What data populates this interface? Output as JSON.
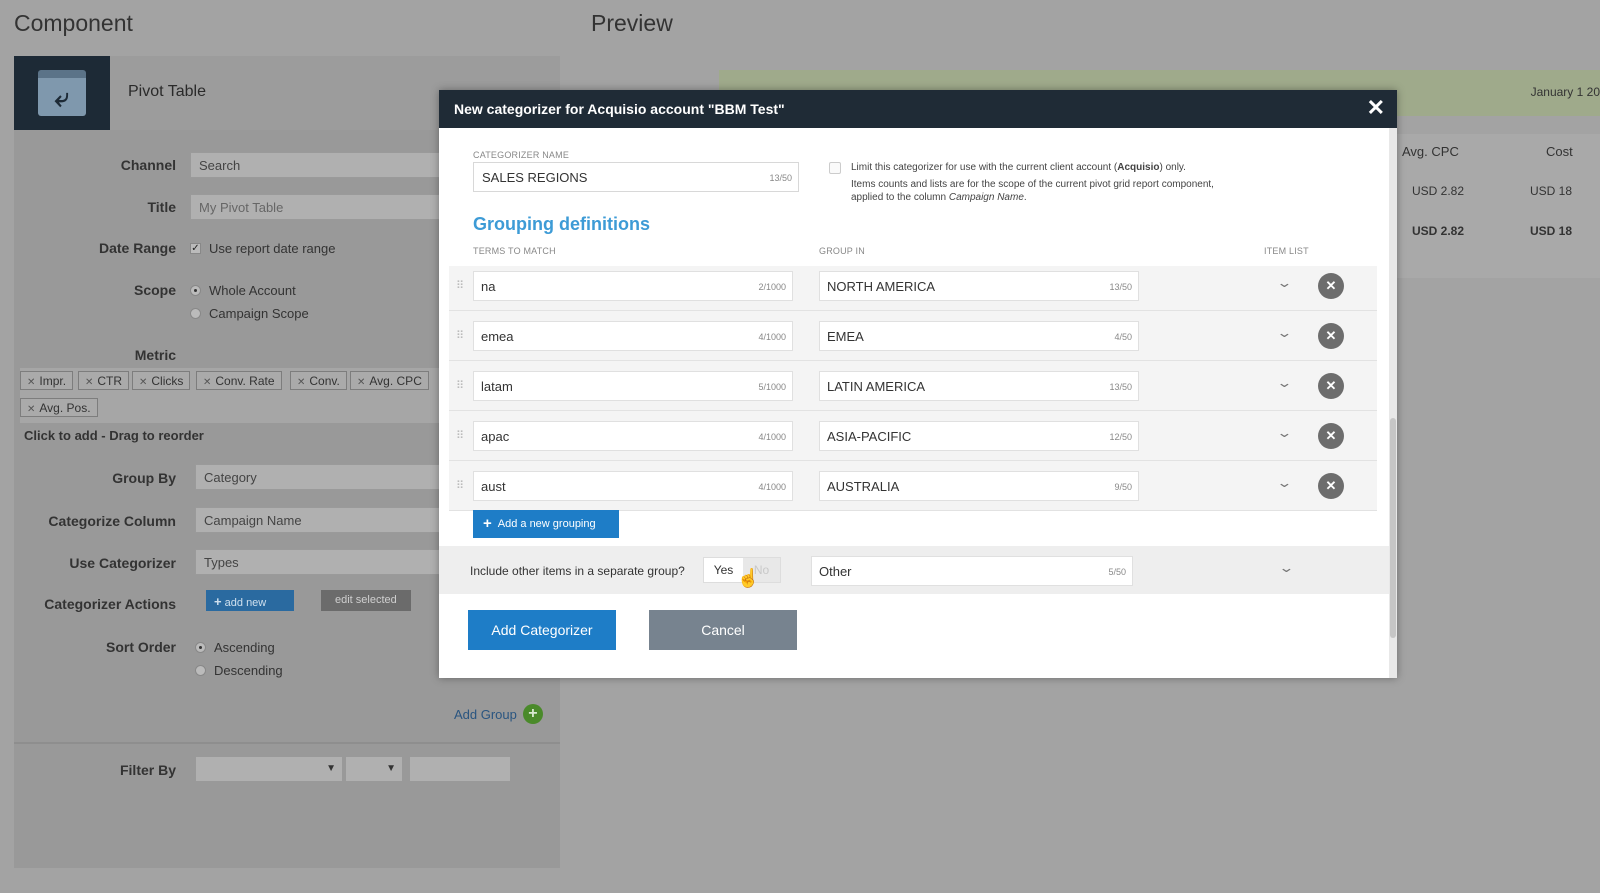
{
  "left": {
    "title": "Component",
    "component_name": "Pivot Table",
    "channel": {
      "label": "Channel",
      "value": "Search"
    },
    "title_field": {
      "label": "Title",
      "placeholder": "My Pivot Table"
    },
    "date_range": {
      "label": "Date Range",
      "option": "Use report date range"
    },
    "scope": {
      "label": "Scope",
      "options": [
        "Whole Account",
        "Campaign Scope"
      ]
    },
    "metric": {
      "label": "Metric",
      "chips": [
        "Impr.",
        "CTR",
        "Clicks",
        "Conv. Rate",
        "Conv.",
        "Avg. CPC",
        "Avg. Pos."
      ],
      "hint": "Click to add - Drag to reorder"
    },
    "group_by": {
      "label": "Group By",
      "value": "Category"
    },
    "categorize_column": {
      "label": "Categorize Column",
      "value": "Campaign Name"
    },
    "use_categorizer": {
      "label": "Use Categorizer",
      "value": "Types"
    },
    "categorizer_actions": {
      "label": "Categorizer Actions",
      "add_new": "add new",
      "edit_selected": "edit selected"
    },
    "sort_order": {
      "label": "Sort Order",
      "options": [
        "Ascending",
        "Descending"
      ]
    },
    "add_group": "Add Group",
    "filter_by": {
      "label": "Filter By"
    }
  },
  "preview": {
    "title": "Preview",
    "date": "January 1 20",
    "headers": [
      "Avg. CPC",
      "Cost"
    ],
    "rows": [
      [
        "USD 2.82",
        "USD 18"
      ],
      [
        "USD 2.82",
        "USD 18"
      ]
    ]
  },
  "modal": {
    "title": "New categorizer for Acquisio account \"BBM Test\"",
    "name_label": "CATEGORIZER NAME",
    "name_value": "SALES REGIONS",
    "name_counter": "13/50",
    "limit_line1_a": "Limit this categorizer for use with the current client account (",
    "limit_line1_b": "Acquisio",
    "limit_line1_c": ") only.",
    "limit_line2": "Items counts and lists are for the scope of the current pivot grid report component,",
    "limit_line3_a": "applied to the column ",
    "limit_line3_b": "Campaign Name",
    "limit_line3_c": ".",
    "grouping_title": "Grouping definitions",
    "col_terms": "TERMS TO MATCH",
    "col_group": "GROUP IN",
    "col_items": "ITEM LIST",
    "groupings": [
      {
        "term": "na",
        "term_count": "2/1000",
        "group": "NORTH AMERICA",
        "group_count": "13/50"
      },
      {
        "term": "emea",
        "term_count": "4/1000",
        "group": "EMEA",
        "group_count": "4/50"
      },
      {
        "term": "latam",
        "term_count": "5/1000",
        "group": "LATIN AMERICA",
        "group_count": "13/50"
      },
      {
        "term": "apac",
        "term_count": "4/1000",
        "group": "ASIA-PACIFIC",
        "group_count": "12/50"
      },
      {
        "term": "aust",
        "term_count": "4/1000",
        "group": "AUSTRALIA",
        "group_count": "9/50"
      }
    ],
    "add_grouping": "Add a new grouping",
    "other_label": "Include other items in a separate group?",
    "toggle_yes": "Yes",
    "toggle_no": "No",
    "other_value": "Other",
    "other_counter": "5/50",
    "add_button": "Add Categorizer",
    "cancel_button": "Cancel"
  }
}
